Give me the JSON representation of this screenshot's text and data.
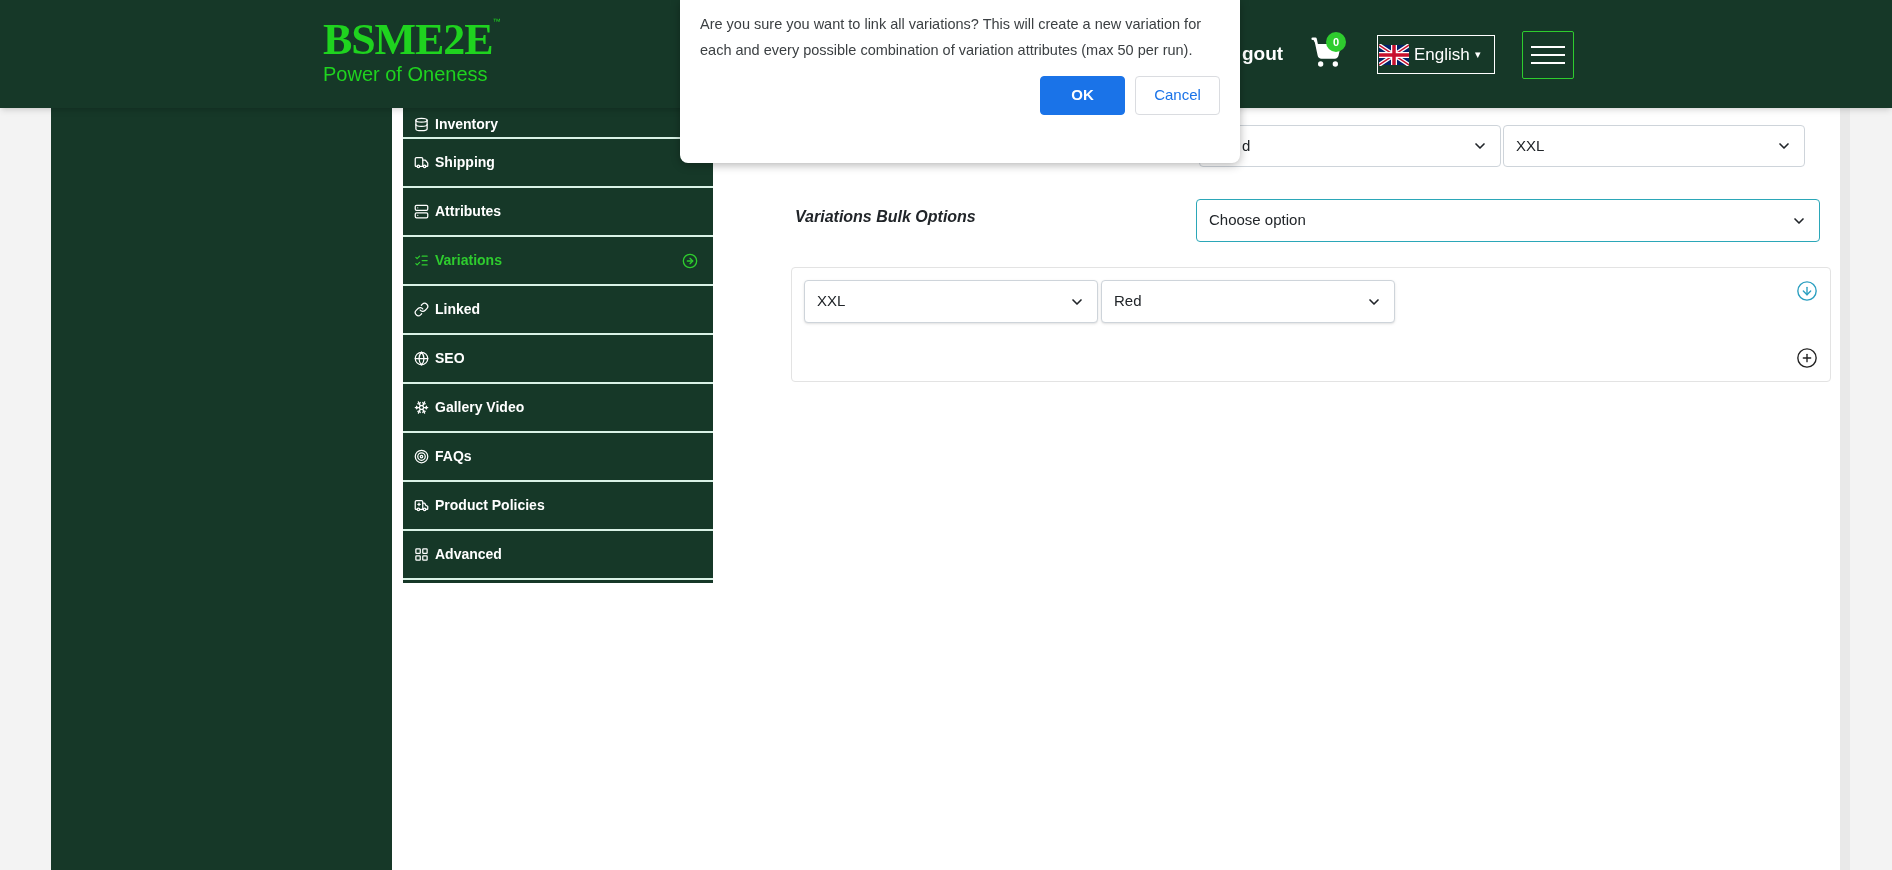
{
  "header": {
    "logo": {
      "title": "BSME2E",
      "trademark": "™",
      "tagline": "Power of Oneness"
    },
    "account_link": "gout",
    "cart": {
      "count": "0"
    },
    "language": {
      "label": "English",
      "caret": "▾"
    }
  },
  "sidebar": {
    "items": [
      {
        "label": "Inventory",
        "selected": false
      },
      {
        "label": "Shipping",
        "selected": false
      },
      {
        "label": "Attributes",
        "selected": false
      },
      {
        "label": "Variations",
        "selected": true
      },
      {
        "label": "Linked",
        "selected": false
      },
      {
        "label": "SEO",
        "selected": false
      },
      {
        "label": "Gallery Video",
        "selected": false
      },
      {
        "label": "FAQs",
        "selected": false
      },
      {
        "label": "Product Policies",
        "selected": false
      },
      {
        "label": "Advanced",
        "selected": false
      }
    ]
  },
  "content": {
    "attribute_selects": [
      {
        "value": "d"
      },
      {
        "value": "XXL"
      }
    ],
    "bulk_options": {
      "label": "Variations Bulk Options",
      "value": "Choose option"
    },
    "variation": {
      "selects": [
        {
          "value": "XXL"
        },
        {
          "value": "Red"
        }
      ]
    }
  },
  "dialog": {
    "message": "Are you sure you want to link all variations? This will create a new variation for each and every possible combination of variation attributes (max 50 per run).",
    "buttons": [
      {
        "label": "OK",
        "kind": "primary"
      },
      {
        "label": "Cancel",
        "kind": "secondary"
      }
    ]
  }
}
